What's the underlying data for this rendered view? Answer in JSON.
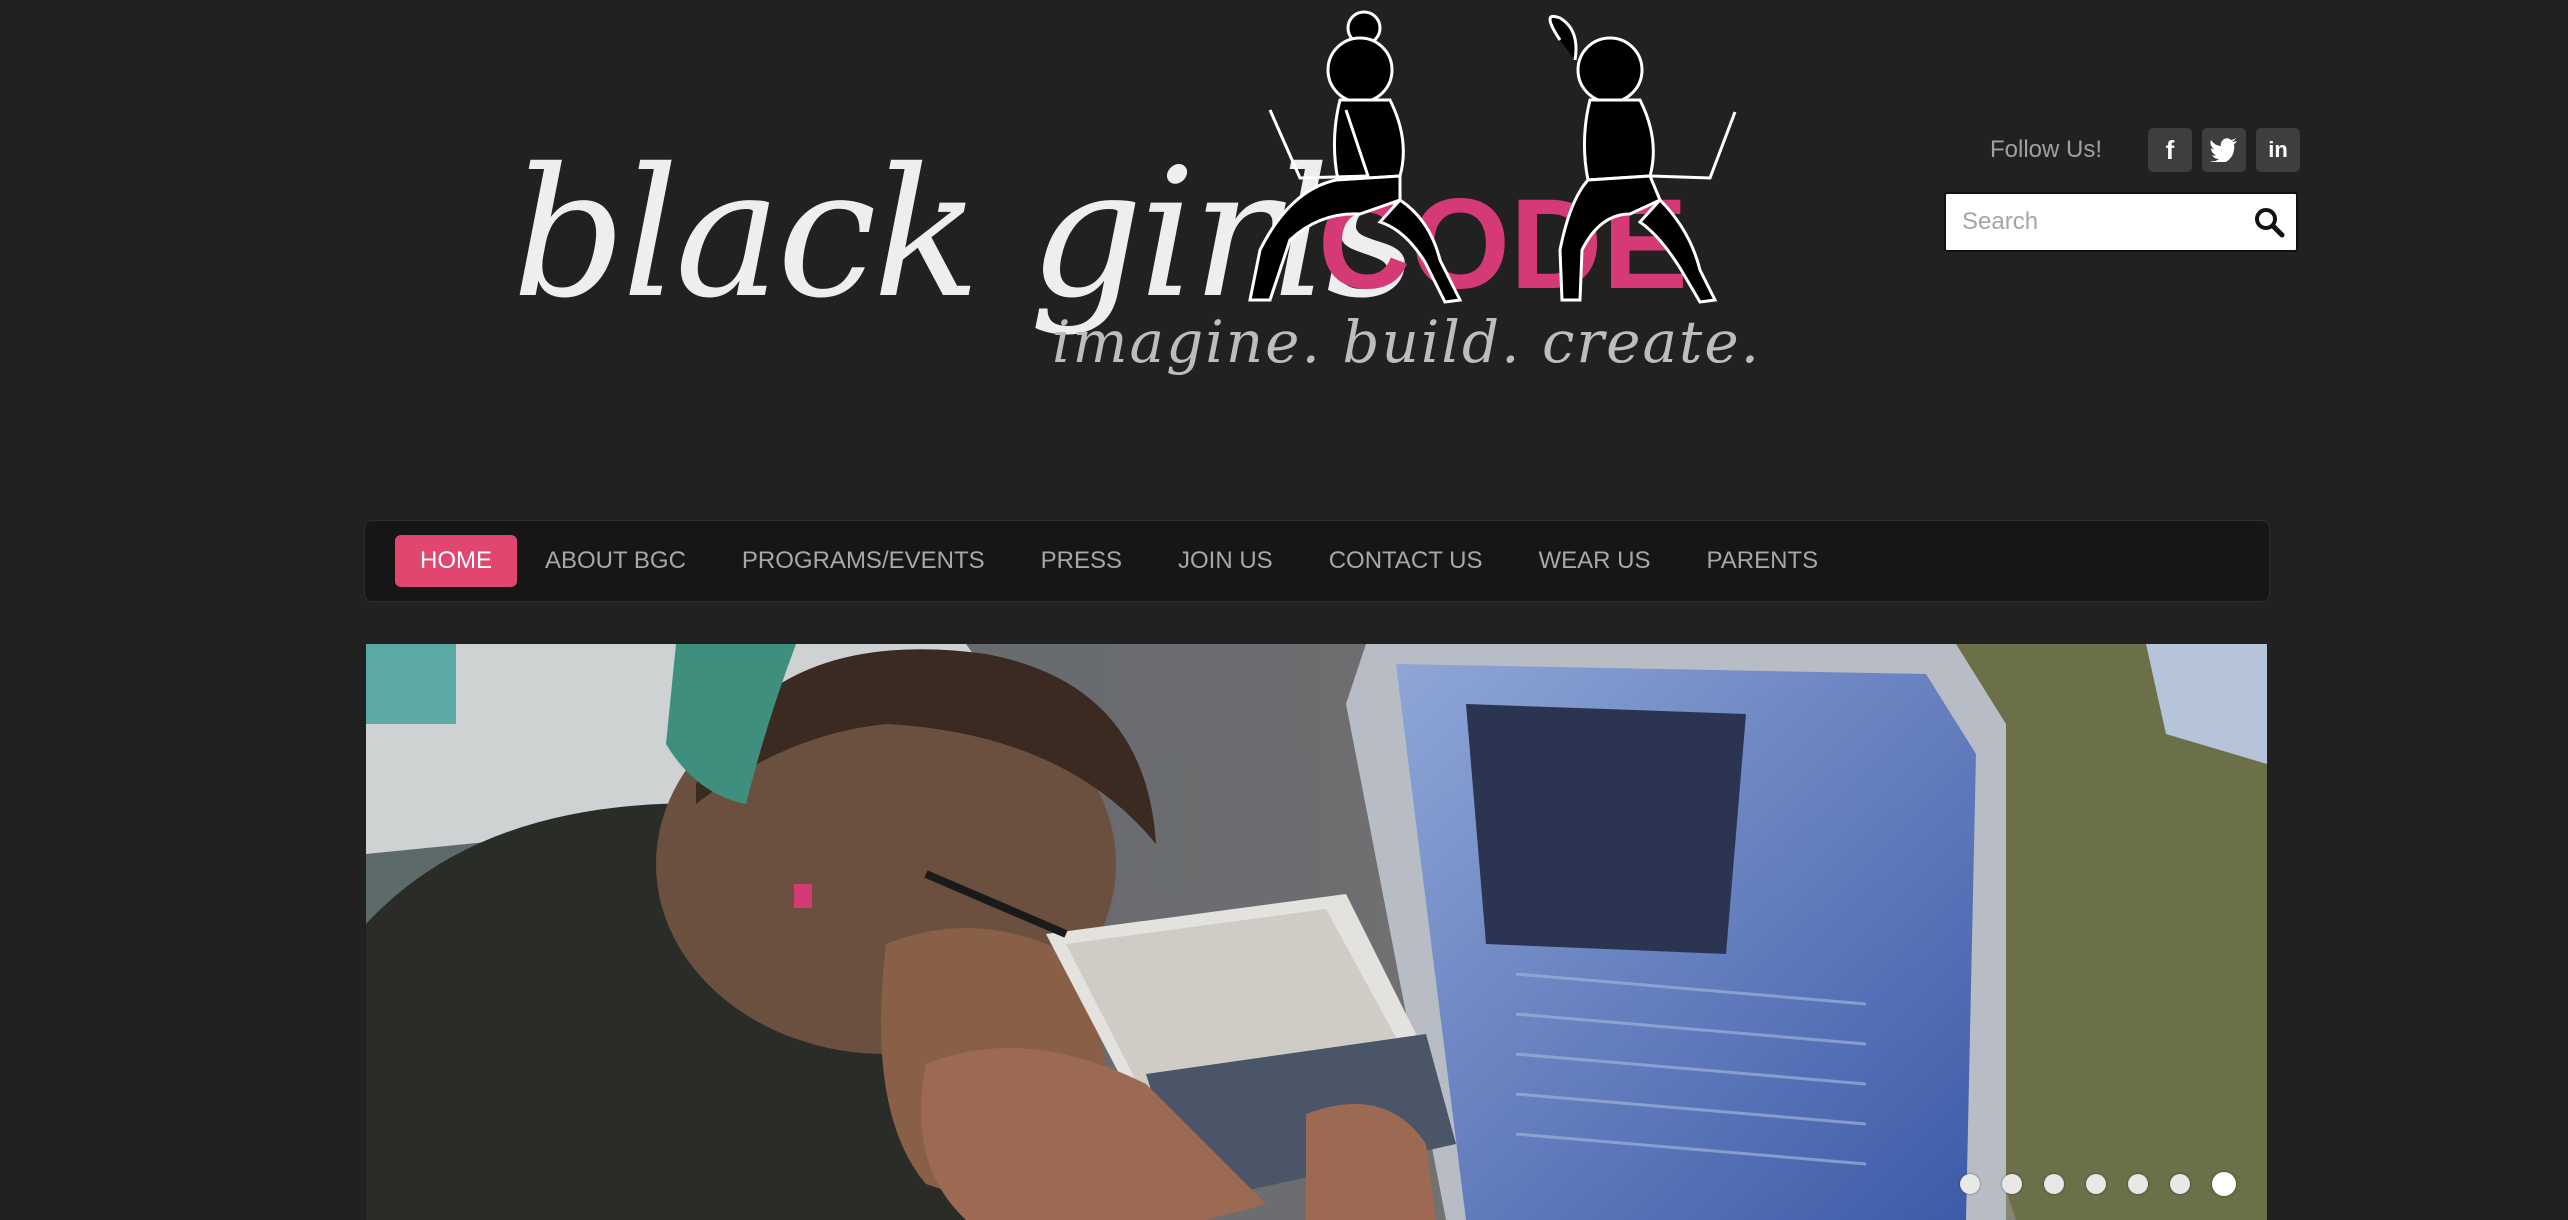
{
  "logo": {
    "word1": "black girls",
    "word2": "CODE",
    "tagline": "imagine. build. create.",
    "accent_color": "#d63a76"
  },
  "social": {
    "label": "Follow Us!",
    "links": [
      {
        "name": "facebook-icon",
        "glyph": "f"
      },
      {
        "name": "twitter-icon",
        "glyph": ""
      },
      {
        "name": "linkedin-icon",
        "glyph": "in"
      }
    ]
  },
  "search": {
    "placeholder": "Search",
    "icon": "search-icon"
  },
  "nav": {
    "items": [
      {
        "label": "HOME",
        "active": true
      },
      {
        "label": "ABOUT BGC"
      },
      {
        "label": "PROGRAMS/EVENTS"
      },
      {
        "label": "PRESS"
      },
      {
        "label": "JOIN US"
      },
      {
        "label": "CONTACT US"
      },
      {
        "label": "WEAR US"
      },
      {
        "label": "PARENTS"
      }
    ],
    "active_color": "#e0466e"
  },
  "slider": {
    "slide_count": 7,
    "active_index": 6
  }
}
